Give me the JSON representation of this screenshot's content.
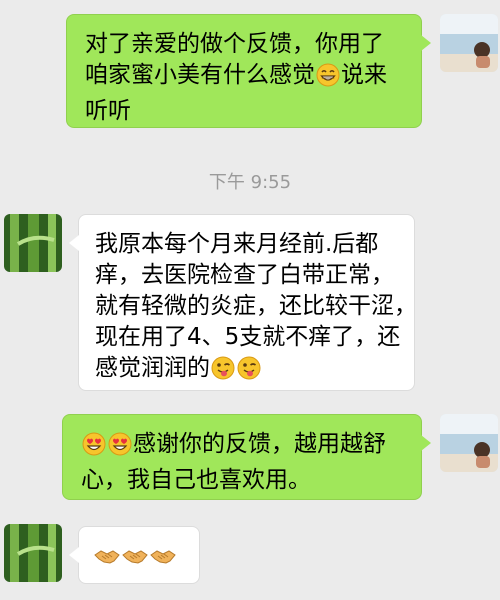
{
  "chat": {
    "messages": [
      {
        "side": "out",
        "lines": [
          "对了亲爱的做个反馈，你用了",
          "咱家蜜小美有什么感觉",
          "说来",
          "听听"
        ],
        "emoji_inline": [
          "grinning-face-emoji"
        ]
      },
      {
        "side": "in",
        "lines": [
          "我原本每个月来月经前.后都",
          "痒，去医院检查了白带正常，",
          "就有轻微的炎症，还比较干涩，",
          "现在用了4、5支就不痒了，还",
          "感觉润润的"
        ],
        "emoji_inline": [
          "winking-tongue-emoji",
          "winking-tongue-emoji"
        ]
      },
      {
        "side": "out",
        "lines": [
          "感谢你的反馈，越用越舒",
          "心，我自己也喜欢用。"
        ],
        "emoji_inline": [
          "heart-eyes-emoji",
          "heart-eyes-emoji"
        ]
      },
      {
        "side": "in",
        "lines": [],
        "emoji_inline": [
          "handshake-emoji",
          "handshake-emoji",
          "handshake-emoji"
        ]
      }
    ],
    "timestamp": "下午 9:55"
  },
  "colors": {
    "background": "#ebebeb",
    "outgoing_bubble": "#a0e75a",
    "incoming_bubble": "#ffffff",
    "timestamp_text": "#9a9a9a"
  }
}
